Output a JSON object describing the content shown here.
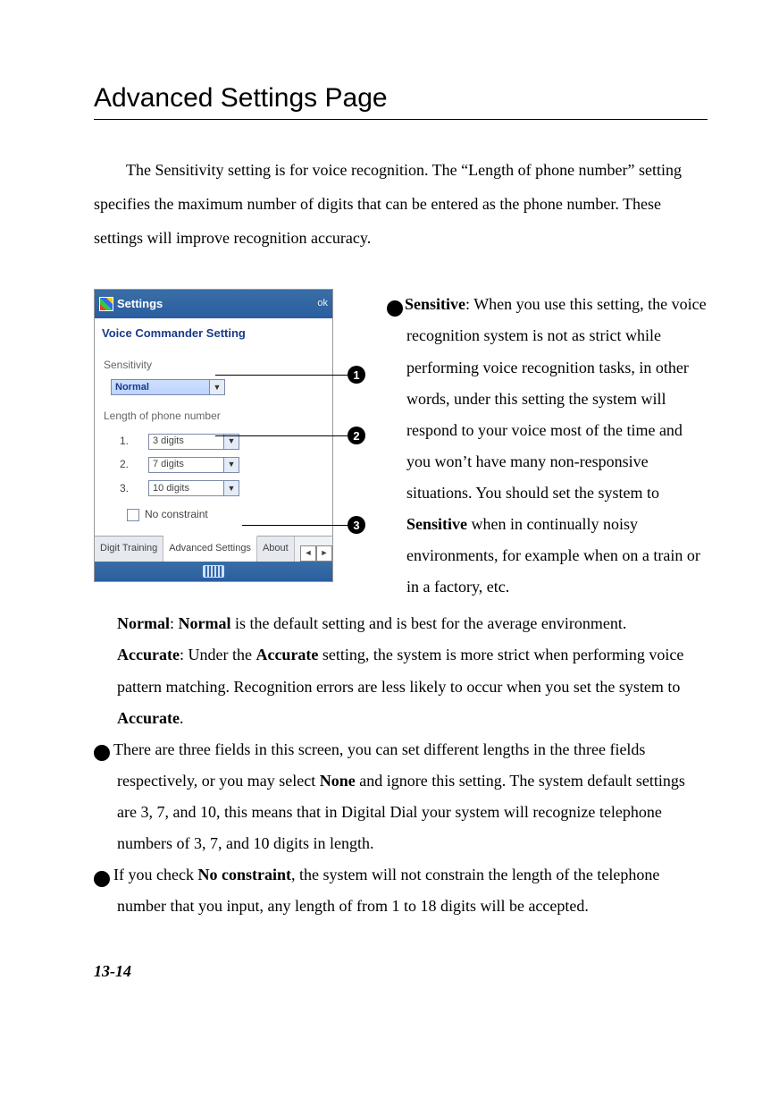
{
  "title": "Advanced Settings Page",
  "intro": "The Sensitivity setting is for voice recognition. The “Length of phone number” setting specifies the maximum number of digits that can be entered as the phone number. These settings will improve recognition accuracy.",
  "screenshot": {
    "titlebar": "Settings",
    "titlebar_right": "ok",
    "window_title": "Voice Commander Setting",
    "group_sensitivity": "Sensitivity",
    "sensitivity_value": "Normal",
    "group_length": "Length of phone number",
    "rows": [
      {
        "n": "1.",
        "val": "3 digits"
      },
      {
        "n": "2.",
        "val": "7 digits"
      },
      {
        "n": "3.",
        "val": "10 digits"
      }
    ],
    "no_constraint": "No constraint",
    "tabs": [
      "Digit Training",
      "Advanced Settings",
      "About"
    ]
  },
  "callouts": {
    "c1": "1",
    "c2": "2",
    "c3": "3"
  },
  "text": {
    "p1_a": "Sensitive",
    "p1_b": ": When you use this setting, the voice recognition system is not as strict while performing voice recognition tasks, in other words, under this setting the system will respond to your voice most of the time and you won’t have many non-responsive situations. You should set the system to ",
    "p1_c": "Sensitive",
    "p1_d": " when in continually noisy environments, for example when on a train or in a factory, etc.",
    "p2_a": "Normal",
    "p2_b": ": ",
    "p2_c": "Normal",
    "p2_d": " is the default setting and is best for the average environment.",
    "p3_a": "Accurate",
    "p3_b": ": Under the ",
    "p3_c": "Accurate",
    "p3_d": " setting, the system is more strict when performing voice pattern matching. Recognition errors are less likely to occur when you set the system to ",
    "p3_e": "Accurate",
    "p3_f": ".",
    "p4_a": "There are three fields in this screen, you can set different lengths in the three fields respectively, or you may select ",
    "p4_b": "None",
    "p4_c": " and ignore this setting. The system default settings are 3, 7, and 10, this means that in Digital Dial your system will recognize telephone numbers of 3, 7, and 10 digits in length.",
    "p5_a": "If you check ",
    "p5_b": "No constraint",
    "p5_c": ", the system will not constrain the length of the telephone number that you input, any length of from 1 to 18 digits will be accepted."
  },
  "page_number": "13-14"
}
